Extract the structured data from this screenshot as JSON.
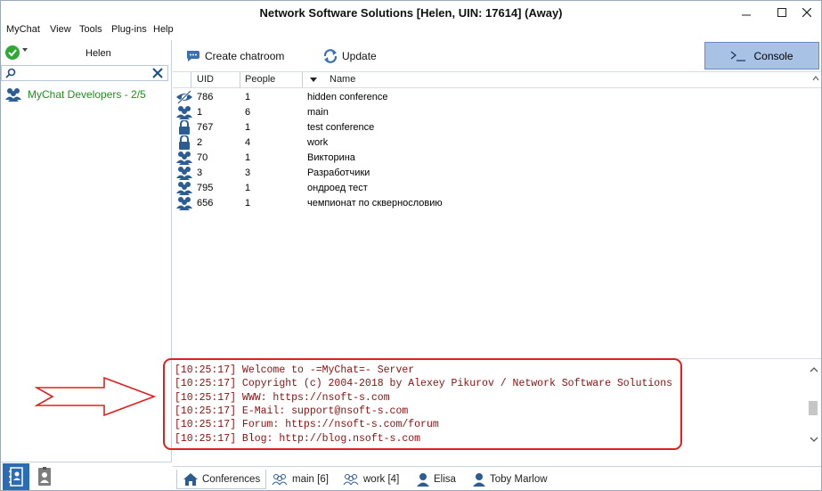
{
  "window": {
    "title": "Network Software Solutions [Helen, UIN: 17614] (Away)"
  },
  "menu": [
    "MyChat",
    "View",
    "Tools",
    "Plug-ins",
    "Help"
  ],
  "user": {
    "name": "Helen"
  },
  "contacts": [
    {
      "label": "MyChat Developers - 2/5"
    }
  ],
  "toolbar": {
    "create": "Create chatroom",
    "update": "Update",
    "console": "Console"
  },
  "table": {
    "headers": {
      "uid": "UID",
      "people": "People",
      "name": "Name"
    },
    "rows": [
      {
        "icon": "hidden-icon",
        "uid": "786",
        "people": "1",
        "name": "hidden conference"
      },
      {
        "icon": "group-icon",
        "uid": "1",
        "people": "6",
        "name": "main"
      },
      {
        "icon": "lock-icon",
        "uid": "767",
        "people": "1",
        "name": "test conference"
      },
      {
        "icon": "lock-icon",
        "uid": "2",
        "people": "4",
        "name": "work"
      },
      {
        "icon": "group-icon",
        "uid": "70",
        "people": "1",
        "name": "Викторина"
      },
      {
        "icon": "group-icon",
        "uid": "3",
        "people": "3",
        "name": "Разработчики"
      },
      {
        "icon": "group-icon",
        "uid": "795",
        "people": "1",
        "name": "ондроед тест"
      },
      {
        "icon": "group-icon",
        "uid": "656",
        "people": "1",
        "name": "чемпионат по сквернословию"
      }
    ]
  },
  "console": {
    "lines": [
      "[10:25:17] Welcome to -=MyChat=- Server",
      "[10:25:17] Copyright (c) 2004-2018 by Alexey Pikurov / Network Software Solutions",
      "[10:25:17] WWW: https://nsoft-s.com",
      "[10:25:17] E-Mail: support@nsoft-s.com",
      "[10:25:17] Forum: https://nsoft-s.com/forum",
      "[10:25:17] Blog: http://blog.nsoft-s.com"
    ]
  },
  "tabs": [
    {
      "label": "Conferences",
      "icon": "home-icon"
    },
    {
      "label": "main [6]",
      "icon": "group-icon"
    },
    {
      "label": "work [4]",
      "icon": "group-icon"
    },
    {
      "label": "Elisa",
      "icon": "person-icon"
    },
    {
      "label": "Toby Marlow",
      "icon": "person-icon"
    }
  ],
  "colors": {
    "accent": "#2b6cb5",
    "console_text": "#8b1010",
    "highlight": "#e0201f",
    "contact_green": "#1e8f1e"
  }
}
